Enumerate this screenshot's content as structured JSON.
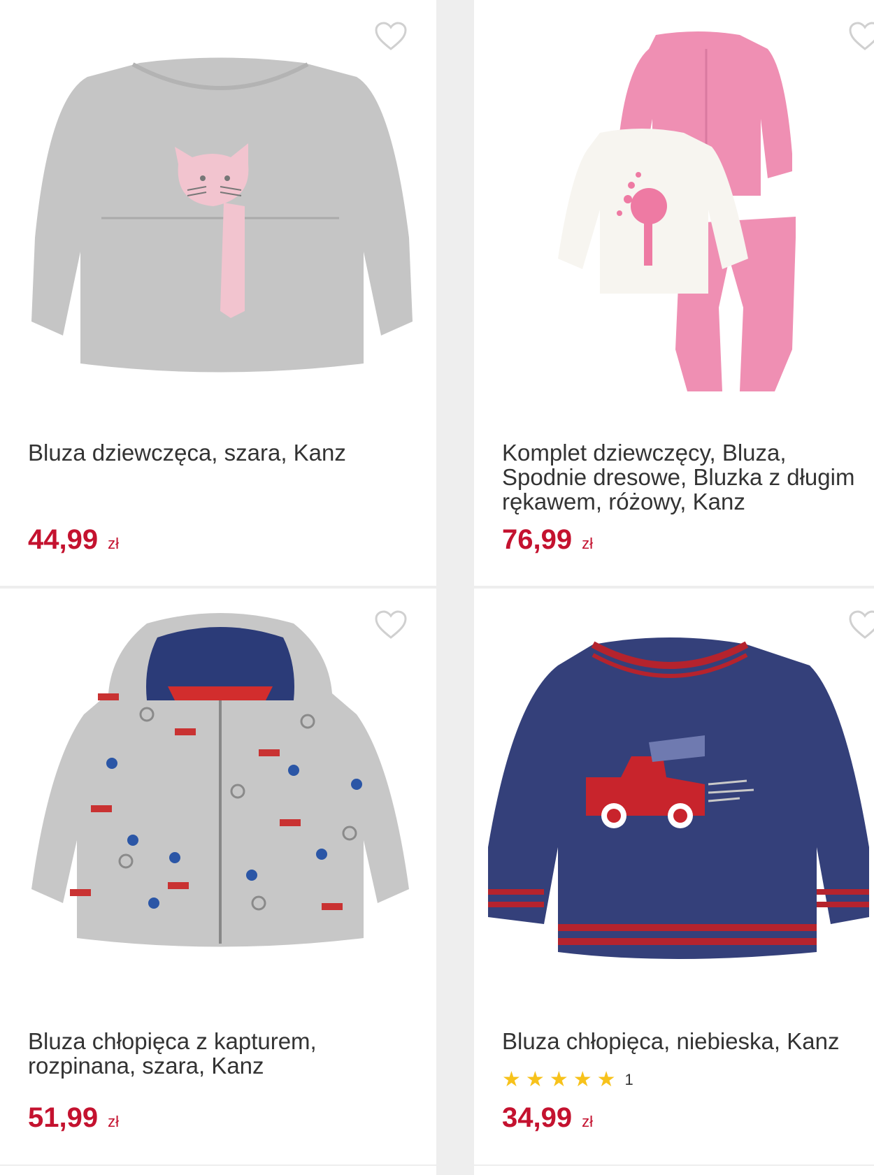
{
  "products": [
    {
      "title": "Bluza dziewczęca, szara, Kanz",
      "price": "44,99",
      "currency": "zł",
      "favorite_icon": "heart-outline-icon"
    },
    {
      "title": "Komplet dziewczęcy, Bluza, Spodnie dresowe, Bluzka z długim rękawem, różowy, Kanz",
      "price": "76,99",
      "currency": "zł",
      "favorite_icon": "heart-outline-icon"
    },
    {
      "title": "Bluza chłopięca z kapturem, rozpinana, szara, Kanz",
      "price": "51,99",
      "currency": "zł",
      "favorite_icon": "heart-outline-icon"
    },
    {
      "title": "Bluza chłopięca, niebieska, Kanz",
      "price": "34,99",
      "currency": "zł",
      "rating": {
        "stars": 5,
        "max": 5,
        "count": "1"
      },
      "favorite_icon": "heart-outline-icon"
    }
  ],
  "colors": {
    "price": "#c4122f",
    "star": "#f7c21b",
    "text": "#333333",
    "background": "#eeeeee",
    "card": "#ffffff"
  }
}
